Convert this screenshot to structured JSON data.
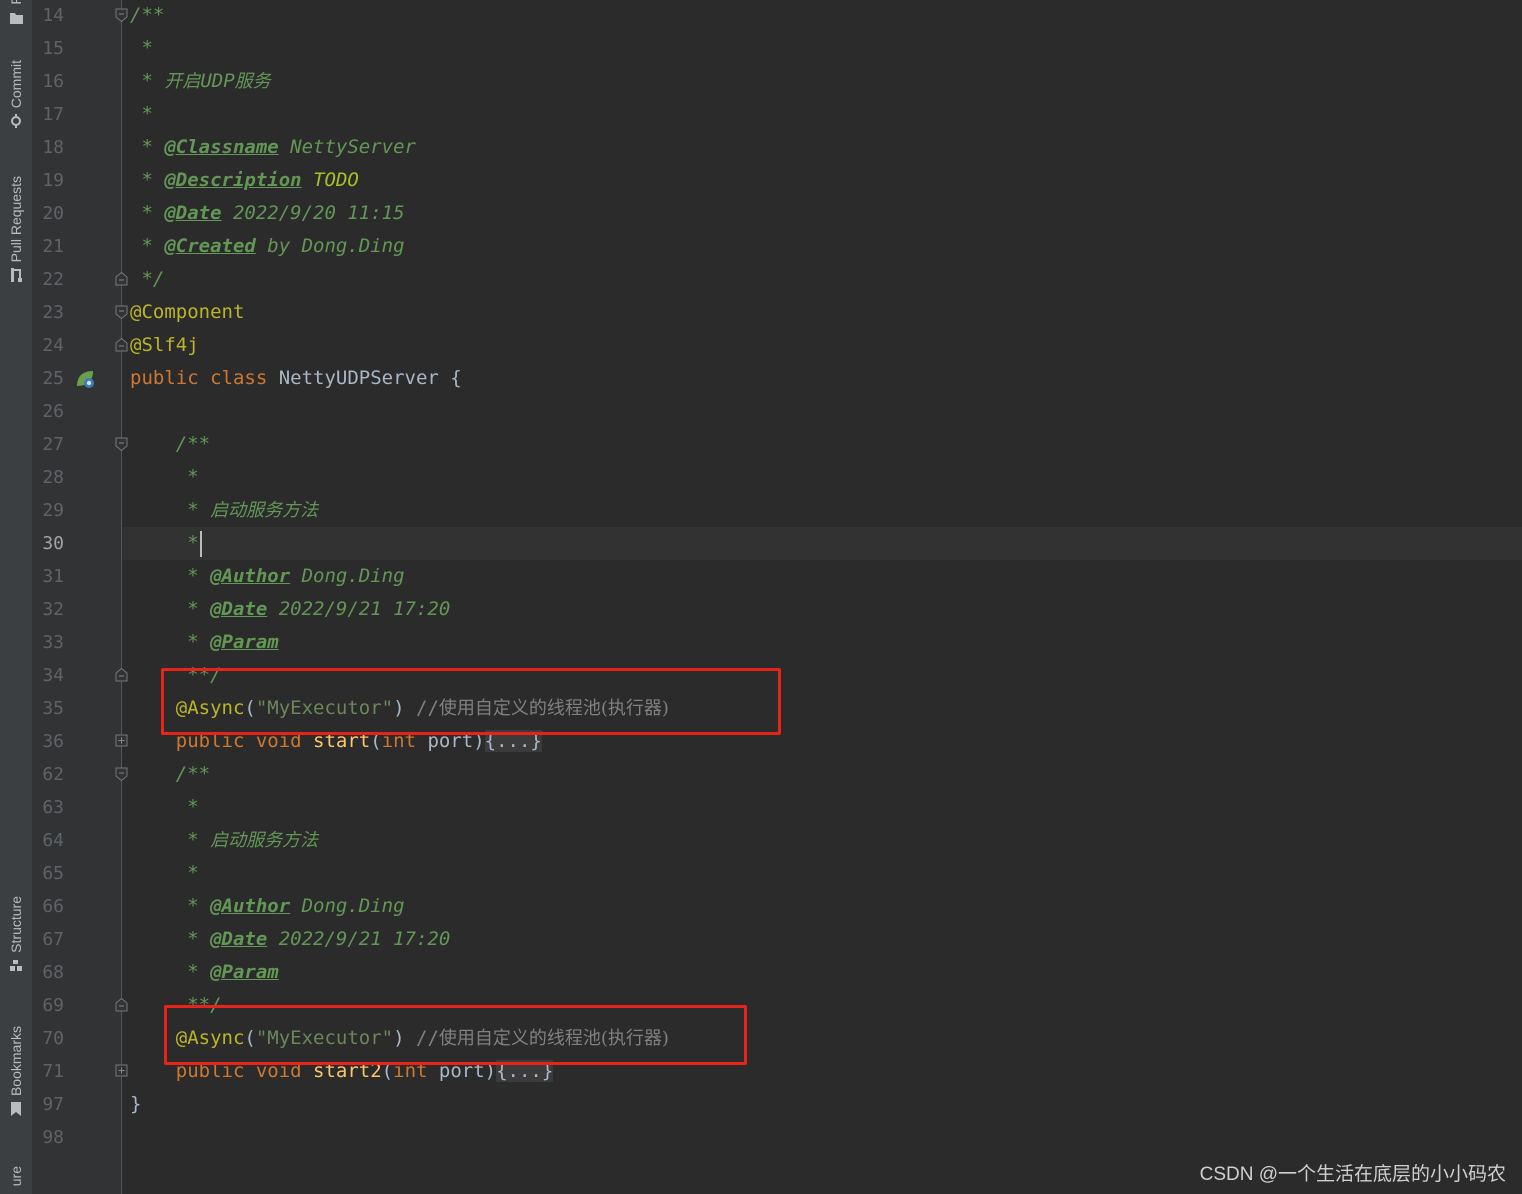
{
  "sidebar": {
    "top_tabs": [
      {
        "label": "F",
        "icon": "folder-icon"
      },
      {
        "label": "Commit",
        "icon": "commit-icon"
      },
      {
        "label": "Pull Requests",
        "icon": "pull-request-icon"
      }
    ],
    "bottom_tabs": [
      {
        "label": "Structure",
        "icon": "structure-icon"
      },
      {
        "label": "Bookmarks",
        "icon": "bookmark-icon"
      },
      {
        "label": "ure",
        "icon": ""
      }
    ]
  },
  "editor": {
    "current_line": "30",
    "lines": [
      {
        "n": "14",
        "parts": [
          {
            "c": "c-doc",
            "t": "/**"
          }
        ]
      },
      {
        "n": "15",
        "parts": [
          {
            "c": "c-doc",
            "t": " *"
          }
        ]
      },
      {
        "n": "16",
        "parts": [
          {
            "c": "c-doc",
            "t": " * "
          },
          {
            "c": "c-doc cjk",
            "t": "开启"
          },
          {
            "c": "c-doc",
            "t": "UDP"
          },
          {
            "c": "c-doc cjk",
            "t": "服务"
          }
        ]
      },
      {
        "n": "17",
        "parts": [
          {
            "c": "c-doc",
            "t": " *"
          }
        ]
      },
      {
        "n": "18",
        "parts": [
          {
            "c": "c-doc",
            "t": " * "
          },
          {
            "c": "c-tag",
            "t": "@Classname"
          },
          {
            "c": "c-doc",
            "t": " NettyServer"
          }
        ]
      },
      {
        "n": "19",
        "parts": [
          {
            "c": "c-doc",
            "t": " * "
          },
          {
            "c": "c-tag",
            "t": "@Description"
          },
          {
            "c": "c-doc",
            "t": " "
          },
          {
            "c": "c-todo",
            "t": "TODO"
          }
        ]
      },
      {
        "n": "20",
        "parts": [
          {
            "c": "c-doc",
            "t": " * "
          },
          {
            "c": "c-tag",
            "t": "@Date"
          },
          {
            "c": "c-doc",
            "t": " 2022/9/20 11:15"
          }
        ]
      },
      {
        "n": "21",
        "parts": [
          {
            "c": "c-doc",
            "t": " * "
          },
          {
            "c": "c-tag",
            "t": "@Created"
          },
          {
            "c": "c-doc",
            "t": " by Dong.Ding"
          }
        ]
      },
      {
        "n": "22",
        "parts": [
          {
            "c": "c-doc",
            "t": " */"
          }
        ]
      },
      {
        "n": "23",
        "parts": [
          {
            "c": "c-ann",
            "t": "@Component"
          }
        ]
      },
      {
        "n": "24",
        "parts": [
          {
            "c": "c-ann",
            "t": "@Slf4j"
          }
        ]
      },
      {
        "n": "25",
        "parts": [
          {
            "c": "c-kw",
            "t": "public class "
          },
          {
            "c": "c-plain",
            "t": "NettyUDPServer {"
          }
        ]
      },
      {
        "n": "26",
        "parts": []
      },
      {
        "n": "27",
        "parts": [
          {
            "c": "c-doc",
            "t": "    /**"
          }
        ]
      },
      {
        "n": "28",
        "parts": [
          {
            "c": "c-doc",
            "t": "     *"
          }
        ]
      },
      {
        "n": "29",
        "parts": [
          {
            "c": "c-doc",
            "t": "     * "
          },
          {
            "c": "c-doc cjk",
            "t": "启动服务方法"
          }
        ]
      },
      {
        "n": "30",
        "parts": [
          {
            "c": "c-doc",
            "t": "     *"
          }
        ],
        "caret": true
      },
      {
        "n": "31",
        "parts": [
          {
            "c": "c-doc",
            "t": "     * "
          },
          {
            "c": "c-tag",
            "t": "@Author"
          },
          {
            "c": "c-doc",
            "t": " Dong.Ding"
          }
        ]
      },
      {
        "n": "32",
        "parts": [
          {
            "c": "c-doc",
            "t": "     * "
          },
          {
            "c": "c-tag",
            "t": "@Date"
          },
          {
            "c": "c-doc",
            "t": " 2022/9/21 17:20"
          }
        ]
      },
      {
        "n": "33",
        "parts": [
          {
            "c": "c-doc",
            "t": "     * "
          },
          {
            "c": "c-tag",
            "t": "@Param"
          }
        ]
      },
      {
        "n": "34",
        "parts": [
          {
            "c": "c-doc",
            "t": "     **/"
          }
        ]
      },
      {
        "n": "35",
        "parts": [
          {
            "c": "c-ann",
            "t": "    @Async"
          },
          {
            "c": "c-plain",
            "t": "("
          },
          {
            "c": "c-str",
            "t": "\"MyExecutor\""
          },
          {
            "c": "c-plain",
            "t": ") "
          },
          {
            "c": "c-cmt",
            "t": "//"
          },
          {
            "c": "c-cmt cjk",
            "t": "使用自定义的线程池(执行器)"
          }
        ]
      },
      {
        "n": "36",
        "parts": [
          {
            "c": "c-kw",
            "t": "    public void "
          },
          {
            "c": "c-fn",
            "t": "start"
          },
          {
            "c": "c-plain",
            "t": "("
          },
          {
            "c": "c-kw",
            "t": "int "
          },
          {
            "c": "c-plain",
            "t": "port)"
          },
          {
            "c": "c-fold",
            "t": "{...}"
          }
        ]
      },
      {
        "n": "62",
        "parts": [
          {
            "c": "c-doc",
            "t": "    /**"
          }
        ]
      },
      {
        "n": "63",
        "parts": [
          {
            "c": "c-doc",
            "t": "     *"
          }
        ]
      },
      {
        "n": "64",
        "parts": [
          {
            "c": "c-doc",
            "t": "     * "
          },
          {
            "c": "c-doc cjk",
            "t": "启动服务方法"
          }
        ]
      },
      {
        "n": "65",
        "parts": [
          {
            "c": "c-doc",
            "t": "     *"
          }
        ]
      },
      {
        "n": "66",
        "parts": [
          {
            "c": "c-doc",
            "t": "     * "
          },
          {
            "c": "c-tag",
            "t": "@Author"
          },
          {
            "c": "c-doc",
            "t": " Dong.Ding"
          }
        ]
      },
      {
        "n": "67",
        "parts": [
          {
            "c": "c-doc",
            "t": "     * "
          },
          {
            "c": "c-tag",
            "t": "@Date"
          },
          {
            "c": "c-doc",
            "t": " 2022/9/21 17:20"
          }
        ]
      },
      {
        "n": "68",
        "parts": [
          {
            "c": "c-doc",
            "t": "     * "
          },
          {
            "c": "c-tag",
            "t": "@Param"
          }
        ]
      },
      {
        "n": "69",
        "parts": [
          {
            "c": "c-doc",
            "t": "     **/"
          }
        ]
      },
      {
        "n": "70",
        "parts": [
          {
            "c": "c-ann",
            "t": "    @Async"
          },
          {
            "c": "c-plain",
            "t": "("
          },
          {
            "c": "c-str",
            "t": "\"MyExecutor\""
          },
          {
            "c": "c-plain",
            "t": ") "
          },
          {
            "c": "c-cmt",
            "t": "//"
          },
          {
            "c": "c-cmt cjk",
            "t": "使用自定义的线程池(执行器)"
          }
        ]
      },
      {
        "n": "71",
        "parts": [
          {
            "c": "c-kw",
            "t": "    public void "
          },
          {
            "c": "c-fn",
            "t": "start2"
          },
          {
            "c": "c-plain",
            "t": "("
          },
          {
            "c": "c-kw",
            "t": "int "
          },
          {
            "c": "c-plain",
            "t": "port)"
          },
          {
            "c": "c-fold",
            "t": "{...}"
          }
        ]
      },
      {
        "n": "97",
        "parts": [
          {
            "c": "c-plain",
            "t": "}"
          }
        ]
      },
      {
        "n": "98",
        "parts": []
      }
    ]
  },
  "colors": {
    "editor_bg": "#2b2b2b",
    "gutter_bg": "#313335",
    "highlight_box": "#e8231a",
    "doc_comment": "#629755",
    "keyword": "#cc7832",
    "annotation": "#bbb529",
    "method": "#ffc66d"
  },
  "watermark": "CSDN @一个生活在底层的小小码农"
}
